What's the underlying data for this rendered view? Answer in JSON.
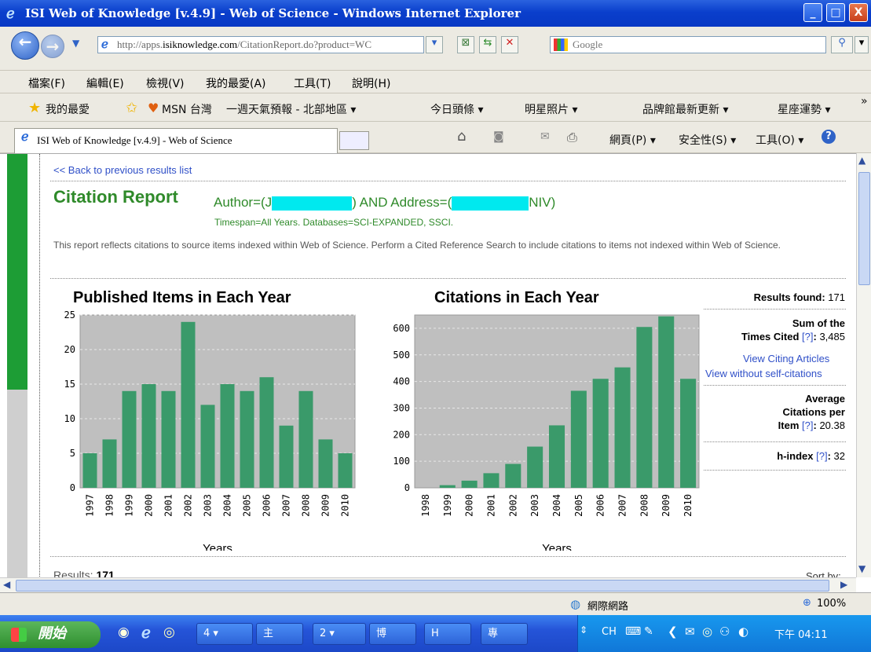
{
  "window": {
    "title": "ISI Web of Knowledge [v.4.9] - Web of Science - Windows Internet Explorer",
    "controls": [
      "_",
      "□",
      "X"
    ]
  },
  "address": {
    "url_prefix": "http://apps.",
    "url_host": "isiknowledge.com",
    "url_path": "/CitationReport.do?product=WC",
    "search_placeholder": "Google"
  },
  "menu": [
    "檔案(F)",
    "編輯(E)",
    "檢視(V)",
    "我的最愛(A)",
    "工具(T)",
    "說明(H)"
  ],
  "favorites": {
    "label": "我的最愛",
    "items": [
      "MSN 台灣",
      "一週天氣預報 - 北部地區 ▾",
      "今日頭條 ▾",
      "明星照片 ▾",
      "品牌館最新更新 ▾",
      "星座運勢 ▾"
    ],
    "more": "»"
  },
  "tab": {
    "title": "ISI Web of Knowledge [v.4.9] - Web of Science"
  },
  "commands": [
    "網頁(P) ▾",
    "安全性(S) ▾",
    "工具(O) ▾"
  ],
  "page": {
    "back_link": "<< Back to previous results list",
    "title": "Citation Report",
    "query_a": "Author=(J",
    "query_b": ") AND Address=(",
    "query_c": "NIV)",
    "timespan": "Timespan=All Years. Databases=SCI-EXPANDED, SSCI.",
    "description": "This report reflects citations to source items indexed within Web of Science. Perform a Cited Reference Search to include citations to items not indexed within Web of Science.",
    "results_prefix": "Results:",
    "results_value": "171",
    "sort_by": "Sort by:"
  },
  "stats": {
    "results_found_label": "Results found:",
    "results_found": "171",
    "sum_label_1": "Sum of the",
    "sum_label_2": "Times Cited",
    "sum_value": "3,485",
    "help": "[?]",
    "view_citing": "View Citing Articles",
    "view_without_self": "View without self-citations",
    "avg_label_1": "Average",
    "avg_label_2": "Citations per",
    "avg_label_3": "Item",
    "avg_value": "20.38",
    "h_label": "h-index",
    "h_value": "32"
  },
  "chart_data": [
    {
      "type": "bar",
      "title": "Published Items in Each Year",
      "xlabel": "Years",
      "ylabel": "",
      "ylim": [
        0,
        25
      ],
      "yticks": [
        0,
        5,
        10,
        15,
        20,
        25
      ],
      "categories": [
        "1997",
        "1998",
        "1999",
        "2000",
        "2001",
        "2002",
        "2003",
        "2004",
        "2005",
        "2006",
        "2007",
        "2008",
        "2009",
        "2010"
      ],
      "values": [
        5,
        7,
        14,
        15,
        14,
        24,
        12,
        15,
        14,
        16,
        9,
        14,
        7,
        5
      ],
      "color": "#3a9a6a",
      "grid": true
    },
    {
      "type": "bar",
      "title": "Citations in Each Year",
      "xlabel": "Years",
      "ylabel": "",
      "ylim": [
        0,
        650
      ],
      "yticks": [
        0,
        100,
        200,
        300,
        400,
        500,
        600
      ],
      "categories": [
        "1998",
        "1999",
        "2000",
        "2001",
        "2002",
        "2003",
        "2004",
        "2005",
        "2006",
        "2007",
        "2008",
        "2009",
        "2010"
      ],
      "values": [
        0,
        10,
        27,
        55,
        90,
        155,
        235,
        365,
        410,
        453,
        605,
        645,
        410
      ],
      "color": "#3a9a6a",
      "grid": true
    }
  ],
  "status": {
    "zone": "網際網路",
    "zoom": "100%"
  },
  "taskbar": {
    "start": "開始",
    "tasks": [
      "4 ▾",
      "主",
      "2 ▾",
      "博",
      "H",
      "專"
    ],
    "lang": "CH",
    "time": "下午 04:11"
  }
}
